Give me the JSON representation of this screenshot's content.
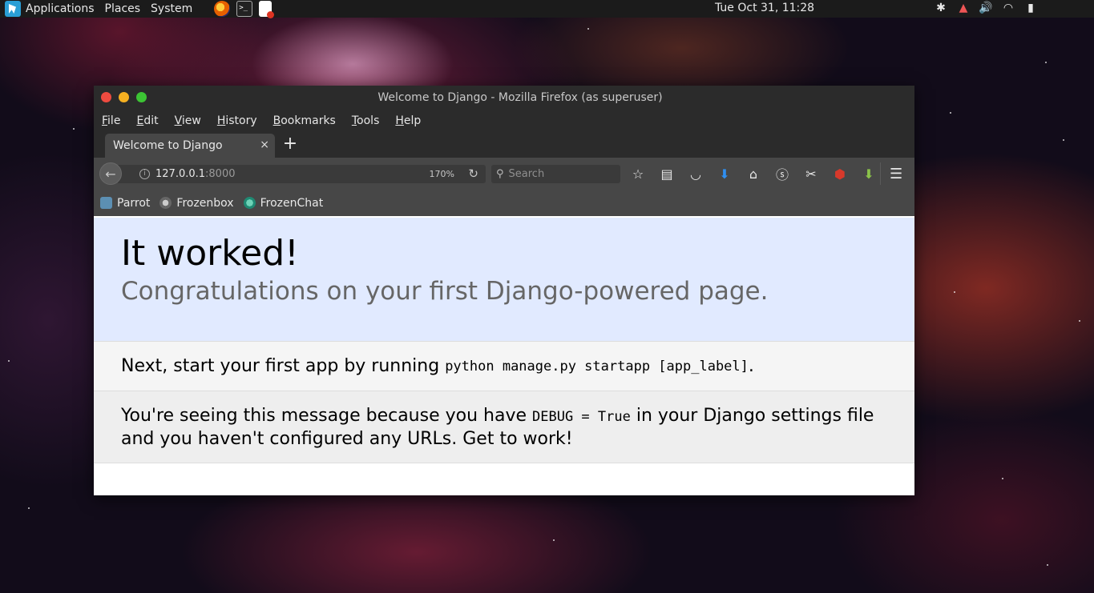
{
  "top_panel": {
    "menus": [
      "Applications",
      "Places",
      "System"
    ],
    "clock": "Tue Oct 31, 11:28"
  },
  "window": {
    "title": "Welcome to Django - Mozilla Firefox (as superuser)",
    "menu": [
      "File",
      "Edit",
      "View",
      "History",
      "Bookmarks",
      "Tools",
      "Help"
    ],
    "tab": {
      "label": "Welcome to Django",
      "close": "×"
    },
    "new_tab": "+",
    "url": {
      "host": "127.0.0.1",
      "port": ":8000",
      "zoom": "170%"
    },
    "search": {
      "placeholder": "Search"
    },
    "bookmarks": [
      "Parrot",
      "Frozenbox",
      "FrozenChat"
    ]
  },
  "page": {
    "heading": "It worked!",
    "subheading": "Congratulations on your first Django-powered page.",
    "next_text": "Next, start your first app by running ",
    "next_code": "python manage.py startapp [app_label]",
    "next_end": ".",
    "debug_pre": "You're seeing this message because you have ",
    "debug_code": "DEBUG = True",
    "debug_post": " in your Django settings file and you haven't configured any URLs. Get to work!"
  },
  "colors": {
    "hero_bg": "#e1eaff",
    "toolbar_bg": "#474747",
    "titlebar_bg": "#2b2b2b"
  }
}
